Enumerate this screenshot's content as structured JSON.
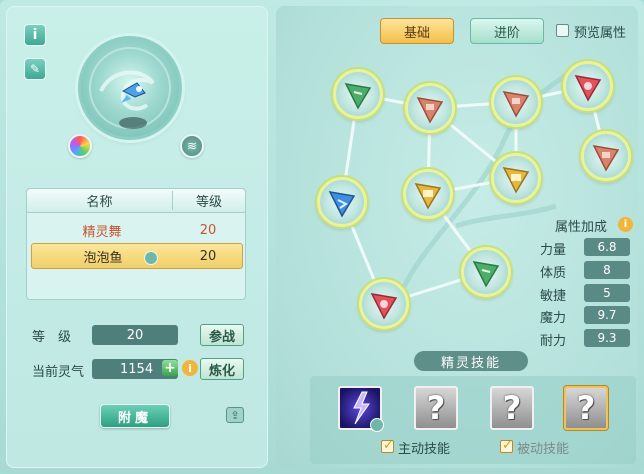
{
  "spirit": {
    "table_headers": [
      "名称",
      "等级"
    ],
    "rows": [
      {
        "name": "精灵舞",
        "level": "20"
      },
      {
        "name": "泡泡鱼",
        "level": "20"
      }
    ]
  },
  "form": {
    "level_label": "等　级",
    "level_value": "20",
    "join_battle_label": "参战",
    "spirit_energy_label": "当前灵气",
    "spirit_energy_value": "1154",
    "refine_label": "炼化",
    "enchant_label": "附魔"
  },
  "tabs": {
    "basic_label": "基础",
    "advanced_label": "进阶",
    "preview_label": "预览属性"
  },
  "attributes": {
    "title": "属性加成",
    "items": [
      {
        "label": "力量",
        "value": "6.8"
      },
      {
        "label": "体质",
        "value": "8"
      },
      {
        "label": "敏捷",
        "value": "5"
      },
      {
        "label": "魔力",
        "value": "9.7"
      },
      {
        "label": "耐力",
        "value": "9.3"
      }
    ]
  },
  "skills": {
    "title": "精灵技能",
    "unknown_glyph": "?",
    "active_label": "主动技能",
    "passive_label": "被动技能"
  },
  "colors": {
    "accent_gold": "#f3bf4a",
    "node_green": "#4cae6a",
    "node_red": "#e0525c",
    "node_salmon": "#d9826c",
    "node_yellow": "#e6b73a",
    "node_blue": "#3f8fe0"
  },
  "icons": {
    "info_button": "info-icon",
    "edit_button": "edit-icon",
    "color_wheel": "color-wheel-icon",
    "wind": "wind-icon",
    "plus": "plus-icon",
    "help": "help-icon",
    "export": "export-icon"
  }
}
